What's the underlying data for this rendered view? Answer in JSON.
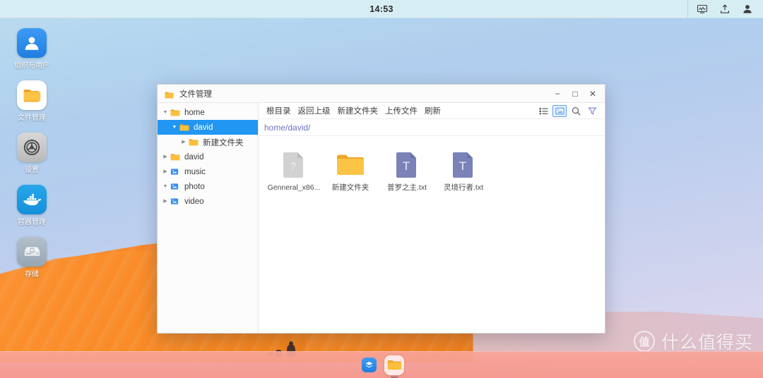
{
  "topbar": {
    "clock": "14:53",
    "tray": [
      {
        "name": "monitor-stats-icon",
        "label": "monitor-stats"
      },
      {
        "name": "upload-icon",
        "label": "upload"
      },
      {
        "name": "user-account-icon",
        "label": "user"
      }
    ]
  },
  "desktop": {
    "icons": [
      {
        "label": "组织与用户",
        "icon": "users-icon"
      },
      {
        "label": "文件管理",
        "icon": "folder-icon"
      },
      {
        "label": "设置",
        "icon": "gear-icon"
      },
      {
        "label": "容器管理",
        "icon": "docker-whale-icon"
      },
      {
        "label": "存储",
        "icon": "hard-drive-icon"
      }
    ]
  },
  "file_manager": {
    "title": "文件管理",
    "window_buttons": {
      "minimize": "−",
      "maximize": "□",
      "close": "✕"
    },
    "sidebar": [
      {
        "label": "home",
        "depth": 0,
        "arrow": "▼",
        "icon": "folder-yellow-icon",
        "selected": false
      },
      {
        "label": "david",
        "depth": 1,
        "arrow": "▼",
        "icon": "folder-yellow-icon",
        "selected": true
      },
      {
        "label": "新建文件夹",
        "depth": 2,
        "arrow": "▶",
        "icon": "folder-yellow-icon",
        "selected": false
      },
      {
        "label": "david",
        "depth": 0,
        "arrow": "▶",
        "icon": "folder-yellow-icon",
        "selected": false
      },
      {
        "label": "music",
        "depth": 0,
        "arrow": "▶",
        "icon": "folder-share-blue-icon",
        "selected": false
      },
      {
        "label": "photo",
        "depth": 0,
        "arrow": "▼",
        "icon": "folder-share-blue-icon",
        "selected": false
      },
      {
        "label": "video",
        "depth": 0,
        "arrow": "▶",
        "icon": "folder-share-blue-icon",
        "selected": false
      }
    ],
    "toolbar": {
      "buttons": [
        "根目录",
        "返回上级",
        "新建文件夹",
        "上传文件",
        "刷新"
      ],
      "view_icons": [
        {
          "name": "list-view-icon",
          "active": false
        },
        {
          "name": "thumbnail-view-icon",
          "active": true
        },
        {
          "name": "search-icon",
          "active": false
        },
        {
          "name": "filter-icon",
          "active": false
        }
      ]
    },
    "breadcrumb": "home/david/",
    "files": [
      {
        "name": "Genneral_x86...",
        "type": "unknown"
      },
      {
        "name": "新建文件夹",
        "type": "folder"
      },
      {
        "name": "普罗之主.txt",
        "type": "text"
      },
      {
        "name": "灵境行者.txt",
        "type": "text"
      }
    ]
  },
  "taskbar": {
    "items": [
      {
        "name": "taskbar-layers-app",
        "active": false
      },
      {
        "name": "taskbar-file-manager",
        "active": true
      }
    ]
  },
  "watermark": {
    "logo": "值",
    "text": "什么值得买"
  },
  "colors": {
    "accent": "#2196f3",
    "folder_yellow": "#fbbf3c",
    "text_file": "#7b82b8",
    "breadcrumb": "#6c73c4",
    "taskbar": "#f8a498",
    "dune_orange": "#f7821e"
  }
}
